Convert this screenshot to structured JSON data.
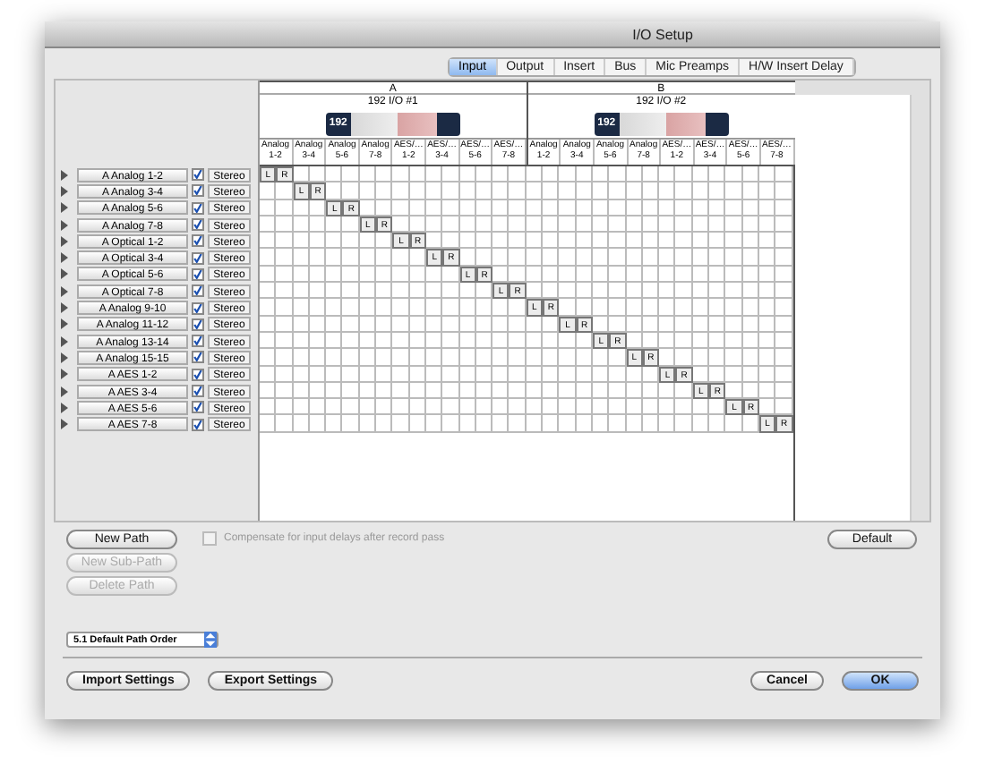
{
  "window": {
    "title": "I/O Setup"
  },
  "tabs": [
    {
      "label": "Input",
      "selected": true
    },
    {
      "label": "Output",
      "selected": false
    },
    {
      "label": "Insert",
      "selected": false
    },
    {
      "label": "Bus",
      "selected": false
    },
    {
      "label": "Mic Preamps",
      "selected": false
    },
    {
      "label": "H/W Insert Delay",
      "selected": false
    }
  ],
  "devices": [
    {
      "letter": "A",
      "name": "192 I/O #1",
      "badge": "192",
      "columns": [
        {
          "type": "Analog",
          "range": "1-2"
        },
        {
          "type": "Analog",
          "range": "3-4"
        },
        {
          "type": "Analog",
          "range": "5-6"
        },
        {
          "type": "Analog",
          "range": "7-8"
        },
        {
          "type": "AES/…",
          "range": "1-2"
        },
        {
          "type": "AES/…",
          "range": "3-4"
        },
        {
          "type": "AES/…",
          "range": "5-6"
        },
        {
          "type": "AES/…",
          "range": "7-8"
        }
      ]
    },
    {
      "letter": "B",
      "name": "192 I/O #2",
      "badge": "192",
      "columns": [
        {
          "type": "Analog",
          "range": "1-2"
        },
        {
          "type": "Analog",
          "range": "3-4"
        },
        {
          "type": "Analog",
          "range": "5-6"
        },
        {
          "type": "Analog",
          "range": "7-8"
        },
        {
          "type": "AES/…",
          "range": "1-2"
        },
        {
          "type": "AES/…",
          "range": "3-4"
        },
        {
          "type": "AES/…",
          "range": "5-6"
        },
        {
          "type": "AES/…",
          "range": "7-8"
        }
      ]
    }
  ],
  "paths": [
    {
      "name": "A Analog 1-2",
      "checked": true,
      "format": "Stereo",
      "channels": [
        "L",
        "R"
      ]
    },
    {
      "name": "A Analog 3-4",
      "checked": true,
      "format": "Stereo",
      "channels": [
        "L",
        "R"
      ]
    },
    {
      "name": "A Analog 5-6",
      "checked": true,
      "format": "Stereo",
      "channels": [
        "L",
        "R"
      ]
    },
    {
      "name": "A Analog 7-8",
      "checked": true,
      "format": "Stereo",
      "channels": [
        "L",
        "R"
      ]
    },
    {
      "name": "A Optical 1-2",
      "checked": true,
      "format": "Stereo",
      "channels": [
        "L",
        "R"
      ]
    },
    {
      "name": "A Optical 3-4",
      "checked": true,
      "format": "Stereo",
      "channels": [
        "L",
        "R"
      ]
    },
    {
      "name": "A Optical 5-6",
      "checked": true,
      "format": "Stereo",
      "channels": [
        "L",
        "R"
      ]
    },
    {
      "name": "A Optical 7-8",
      "checked": true,
      "format": "Stereo",
      "channels": [
        "L",
        "R"
      ]
    },
    {
      "name": "A Analog 9-10",
      "checked": true,
      "format": "Stereo",
      "channels": [
        "L",
        "R"
      ]
    },
    {
      "name": "A Analog 11-12",
      "checked": true,
      "format": "Stereo",
      "channels": [
        "L",
        "R"
      ]
    },
    {
      "name": "A Analog 13-14",
      "checked": true,
      "format": "Stereo",
      "channels": [
        "L",
        "R"
      ]
    },
    {
      "name": "A Analog 15-15",
      "checked": true,
      "format": "Stereo",
      "channels": [
        "L",
        "R"
      ]
    },
    {
      "name": "A AES 1-2",
      "checked": true,
      "format": "Stereo",
      "channels": [
        "L",
        "R"
      ]
    },
    {
      "name": "A AES 3-4",
      "checked": true,
      "format": "Stereo",
      "channels": [
        "L",
        "R"
      ]
    },
    {
      "name": "A AES 5-6",
      "checked": true,
      "format": "Stereo",
      "channels": [
        "L",
        "R"
      ]
    },
    {
      "name": "A AES 7-8",
      "checked": true,
      "format": "Stereo",
      "channels": [
        "L",
        "R"
      ]
    }
  ],
  "compensate": {
    "label": "Compensate for input delays after record pass",
    "checked": false,
    "disabled": true
  },
  "default_button": "Default",
  "path_buttons": [
    {
      "label": "New Path",
      "disabled": false
    },
    {
      "label": "New Sub-Path",
      "disabled": true
    },
    {
      "label": "Delete Path",
      "disabled": true
    }
  ],
  "path_order": {
    "value": "5.1 Default Path Order"
  },
  "footer_left": [
    "Import Settings",
    "Export Settings"
  ],
  "footer_right": [
    {
      "label": "Cancel",
      "kind": "normal"
    },
    {
      "label": "OK",
      "kind": "default"
    }
  ]
}
